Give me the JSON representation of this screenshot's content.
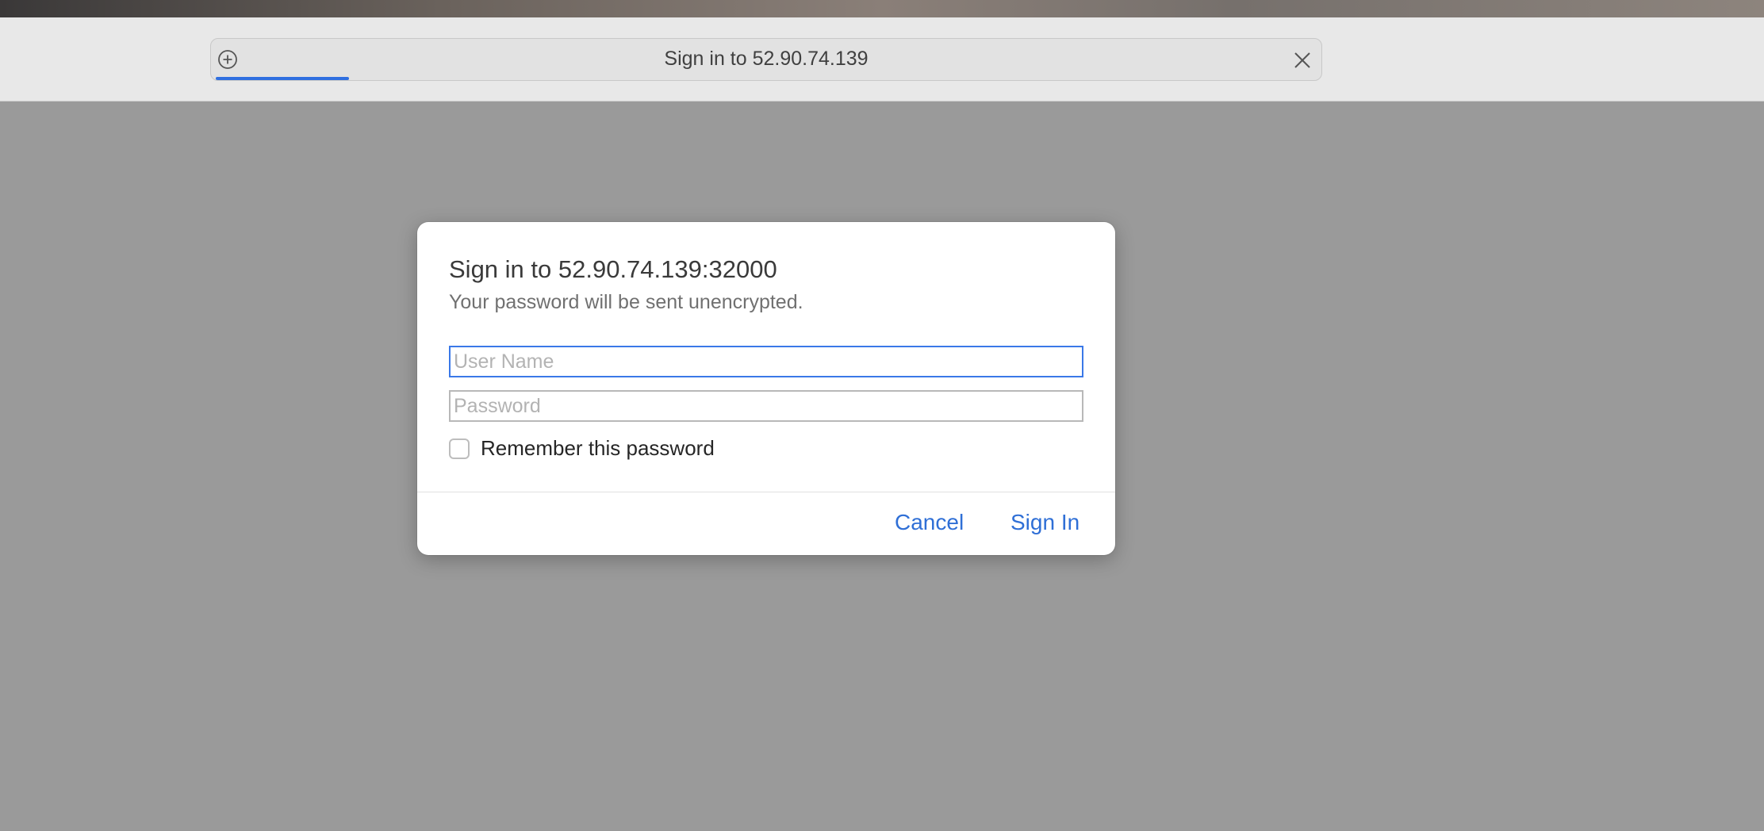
{
  "browser": {
    "address_title": "Sign in to 52.90.74.139",
    "load_progress_percent": 12,
    "icons": {
      "new_tab": "plus-circle-icon",
      "stop": "close-icon"
    }
  },
  "dialog": {
    "title": "Sign in to 52.90.74.139:32000",
    "subtitle": "Your password will be sent unencrypted.",
    "username": {
      "value": "",
      "placeholder": "User Name"
    },
    "password": {
      "value": "",
      "placeholder": "Password"
    },
    "remember_label": "Remember this password",
    "remember_checked": false,
    "cancel_label": "Cancel",
    "signin_label": "Sign In"
  },
  "colors": {
    "accent": "#2f6fd6",
    "focus_ring": "#3a78e8",
    "backdrop": "#9a9a9a"
  }
}
